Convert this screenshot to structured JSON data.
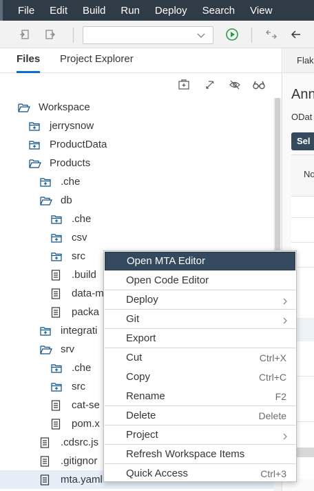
{
  "menubar": {
    "items": [
      "File",
      "Edit",
      "Build",
      "Run",
      "Deploy",
      "Search",
      "View"
    ]
  },
  "toolbar": {
    "icons": [
      "undo-icon",
      "redo-icon",
      "chevron-down-icon",
      "run-icon",
      "split-icon",
      "back-icon"
    ],
    "dropdown_value": ""
  },
  "panel": {
    "tabs": [
      "Files",
      "Project Explorer"
    ],
    "active_tab": "Files",
    "tools": [
      "new-folder-icon",
      "link-icon",
      "hide-icon",
      "glasses-icon"
    ]
  },
  "tree": {
    "items": [
      {
        "label": "Workspace",
        "icon": "folder-open"
      },
      {
        "label": "jerrysnow",
        "icon": "folder-closed"
      },
      {
        "label": "ProductData",
        "icon": "folder-closed"
      },
      {
        "label": "Products",
        "icon": "folder-open"
      },
      {
        "label": ".che",
        "icon": "folder-closed"
      },
      {
        "label": "db",
        "icon": "folder-open"
      },
      {
        "label": ".che",
        "icon": "folder-closed"
      },
      {
        "label": "csv",
        "icon": "folder-closed"
      },
      {
        "label": "src",
        "icon": "folder-closed"
      },
      {
        "label": ".build",
        "icon": "file"
      },
      {
        "label": "data-m",
        "icon": "file"
      },
      {
        "label": "packa",
        "icon": "file"
      },
      {
        "label": "integrati",
        "icon": "folder-closed"
      },
      {
        "label": "srv",
        "icon": "folder-open"
      },
      {
        "label": ".che",
        "icon": "folder-closed"
      },
      {
        "label": "src",
        "icon": "folder-closed"
      },
      {
        "label": "cat-se",
        "icon": "file"
      },
      {
        "label": "pom.x",
        "icon": "file"
      },
      {
        "label": ".cdsrc.js",
        "icon": "file"
      },
      {
        "label": ".gitignor",
        "icon": "file"
      },
      {
        "label": "mta.yaml",
        "icon": "file"
      }
    ]
  },
  "right_panel": {
    "tab": "Flak",
    "title": "Ann",
    "subtitle": "ODat",
    "button": "Sel",
    "column": "No"
  },
  "context_menu": {
    "items": [
      {
        "label": "Open MTA Editor",
        "shortcut": "",
        "submenu": false
      },
      {
        "label": "Open Code Editor",
        "shortcut": "",
        "submenu": false
      },
      {
        "label": "Deploy",
        "shortcut": "",
        "submenu": true
      },
      {
        "label": "Git",
        "shortcut": "",
        "submenu": true
      },
      {
        "label": "Export",
        "shortcut": "",
        "submenu": false
      },
      {
        "label": "Cut",
        "shortcut": "Ctrl+X",
        "submenu": false
      },
      {
        "label": "Copy",
        "shortcut": "Ctrl+C",
        "submenu": false
      },
      {
        "label": "Rename",
        "shortcut": "F2",
        "submenu": false
      },
      {
        "label": "Delete",
        "shortcut": "Delete",
        "submenu": false
      },
      {
        "label": "Project",
        "shortcut": "",
        "submenu": true
      },
      {
        "label": "Refresh Workspace Items",
        "shortcut": "",
        "submenu": false
      },
      {
        "label": "Quick Access",
        "shortcut": "Ctrl+3",
        "submenu": false
      }
    ],
    "highlighted": "Open MTA Editor"
  },
  "colors": {
    "menubar_bg": "#2f3c48",
    "accent": "#0a6ed1",
    "highlight_bg": "#354a5f",
    "run_green": "#2b9a4a",
    "icon_blue": "#0a4f86"
  }
}
